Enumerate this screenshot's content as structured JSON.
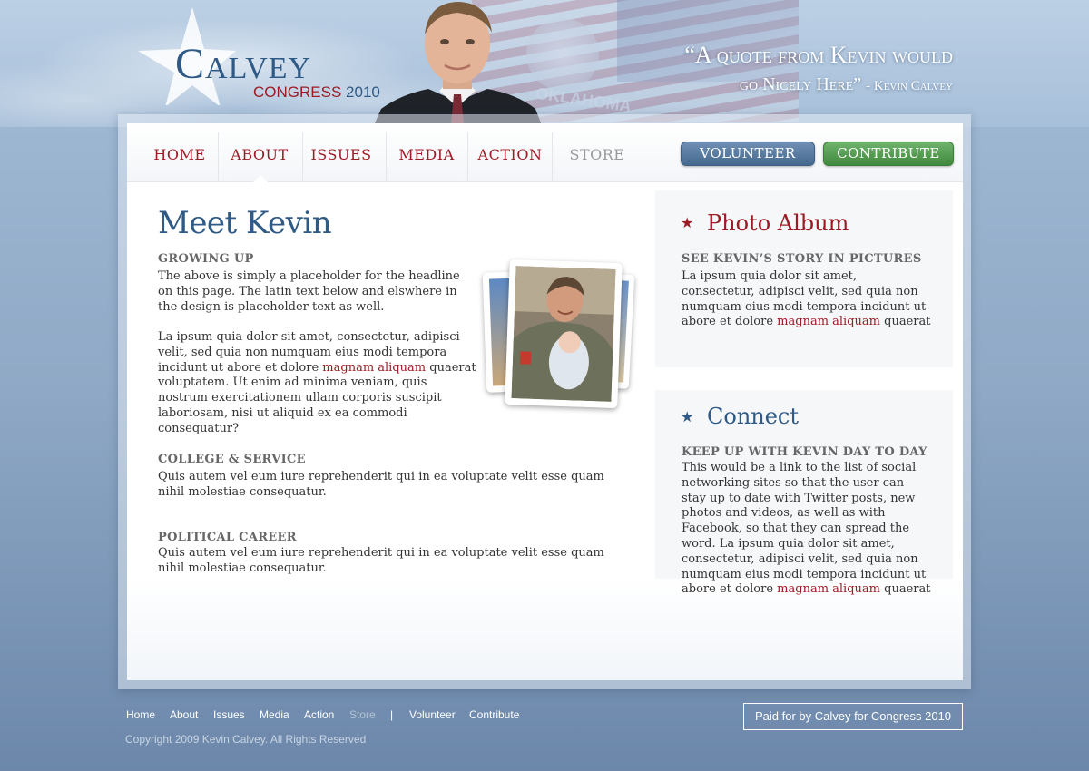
{
  "header": {
    "logo_name": "Calvey",
    "logo_congress": "CONGRESS",
    "logo_year": "2010",
    "flag_text": "OKLAHOMA",
    "quote_line1": "“A quote from Kevin would",
    "quote_line2": "go Nicely Here”",
    "quote_attribution": "- Kevin Calvey"
  },
  "nav": {
    "items": [
      {
        "label": "HOME"
      },
      {
        "label": "ABOUT"
      },
      {
        "label": "ISSUES"
      },
      {
        "label": "MEDIA"
      },
      {
        "label": "ACTION"
      },
      {
        "label": "STORE"
      }
    ],
    "volunteer": "VOLUNTEER",
    "contribute": "CONTRIBUTE"
  },
  "main": {
    "title": "Meet Kevin",
    "growing_up": {
      "heading": "GROWING UP",
      "para1": "The above is simply a placeholder for the headline on this page. The latin text below and elswhere in the design is placeholder text as well.",
      "para2_start": "La ipsum quia dolor sit amet, consectetur, adipisci velit, sed quia non numquam eius modi tempora incidunt ut abore et dolore",
      "para2_link": "magnam aliquam",
      "para2_end": "quaerat voluptatem. Ut enim ad minima veniam, quis nostrum exercitationem ullam corporis suscipit laboriosam, nisi ut aliquid ex ea commodi consequatur?"
    },
    "college": {
      "heading": "COLLEGE & SERVICE",
      "text": "Quis autem vel eum iure reprehenderit qui in ea voluptate velit esse quam nihil molestiae consequatur."
    },
    "political": {
      "heading": "POLITICAL CAREER",
      "text": "Quis autem vel eum iure reprehenderit qui in ea voluptate velit esse quam nihil molestiae consequatur."
    }
  },
  "sidebar": {
    "album": {
      "title": "Photo Album",
      "subheading": "SEE KEVIN’S STORY IN PICTURES",
      "text_start": "La ipsum quia dolor sit amet, consectetur, adipisci velit, sed quia non numquam eius modi tempora incidunt ut  abore et dolore",
      "link": "magnam aliquam",
      "text_end": "quaerat"
    },
    "connect": {
      "title": "Connect",
      "subheading": "KEEP UP WITH KEVIN DAY TO DAY",
      "text_start": "This would be a link to the list of social networking sites so that the user can stay up to date with Twitter posts, new photos and videos, as well as with Facebook, so that they can spread the word. La ipsum quia dolor sit amet, consectetur, adipisci velit, sed quia non numquam eius modi tempora incidunt ut  abore et dolore",
      "link": "magnam aliquam",
      "text_end": "quaerat"
    }
  },
  "footer": {
    "links": [
      "Home",
      "About",
      "Issues",
      "Media",
      "Action",
      "Store"
    ],
    "separator": "|",
    "volunteer": "Volunteer",
    "contribute": "Contribute",
    "copyright": "Copyright 2009 Kevin Calvey. All Rights Reserved",
    "paid_for": "Paid for by Calvey for Congress 2010"
  },
  "colors": {
    "accent_red": "#9d1b24",
    "accent_blue": "#2f5a86",
    "volunteer_blue": "#45698f",
    "contribute_green": "#3f8a3c"
  }
}
